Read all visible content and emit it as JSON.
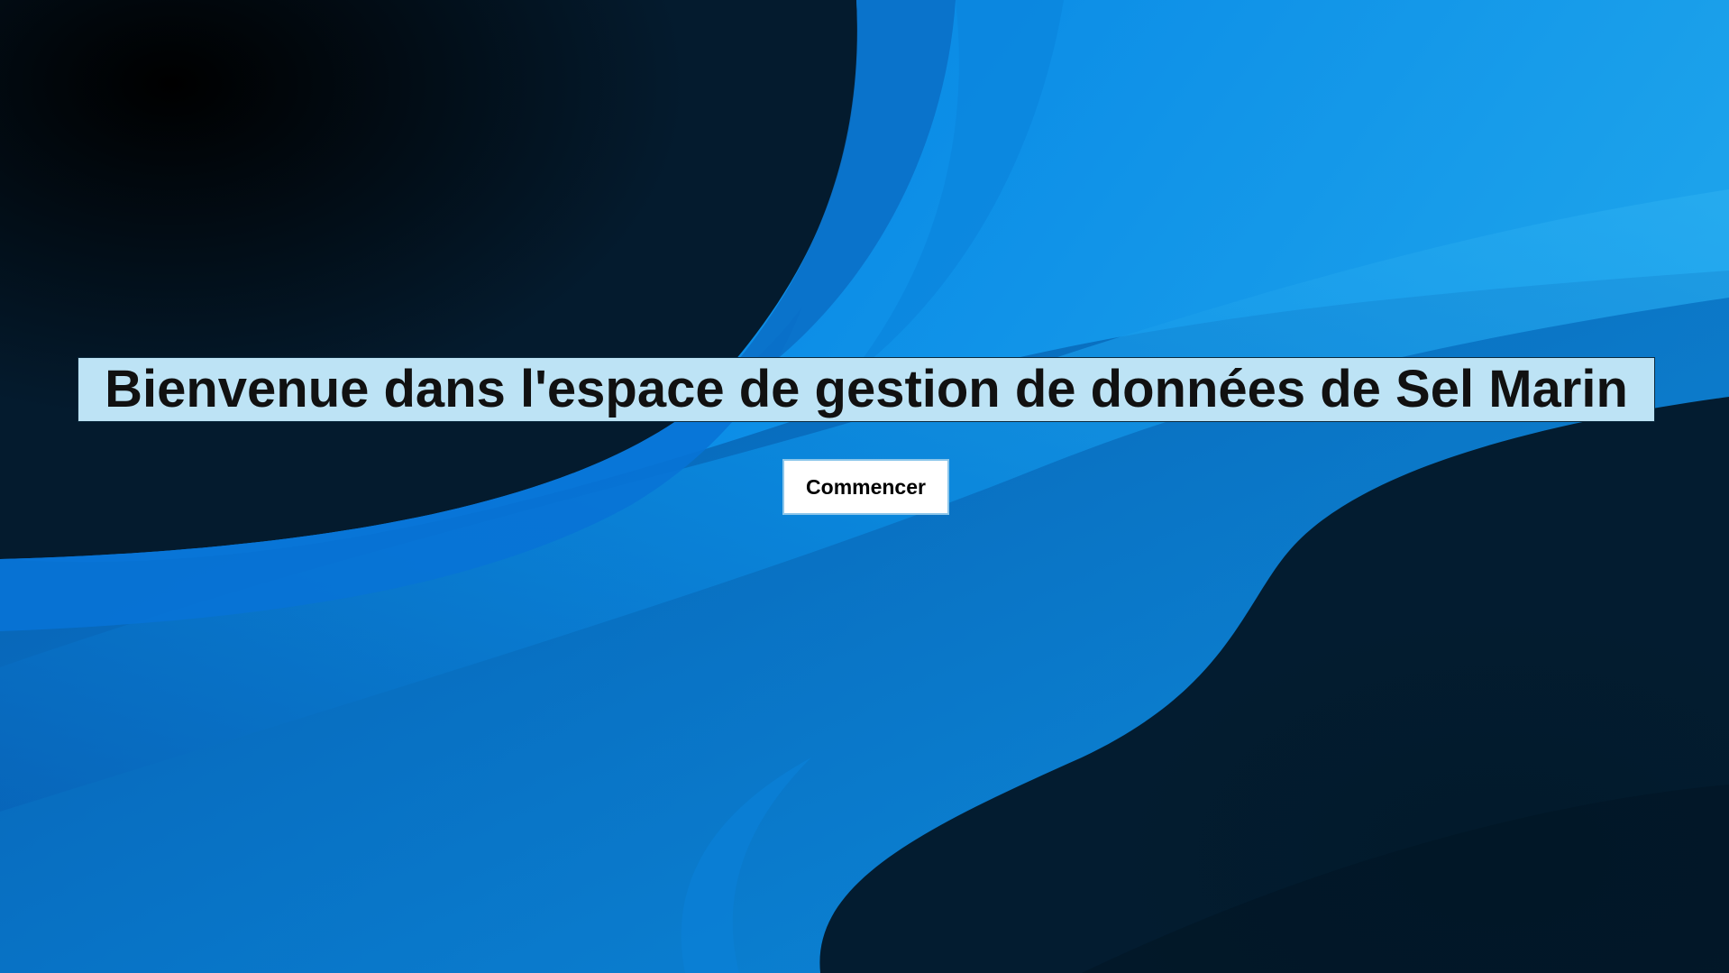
{
  "colors": {
    "background_dark": "#01101c",
    "background_blue": "#0a8be6",
    "banner_background": "#bde3f5",
    "title_text": "#111111",
    "button_background": "#ffffff",
    "button_border": "#8cc6ea"
  },
  "welcome": {
    "title": "Bienvenue dans l'espace de gestion de données de Sel Marin"
  },
  "actions": {
    "start_label": "Commencer"
  }
}
